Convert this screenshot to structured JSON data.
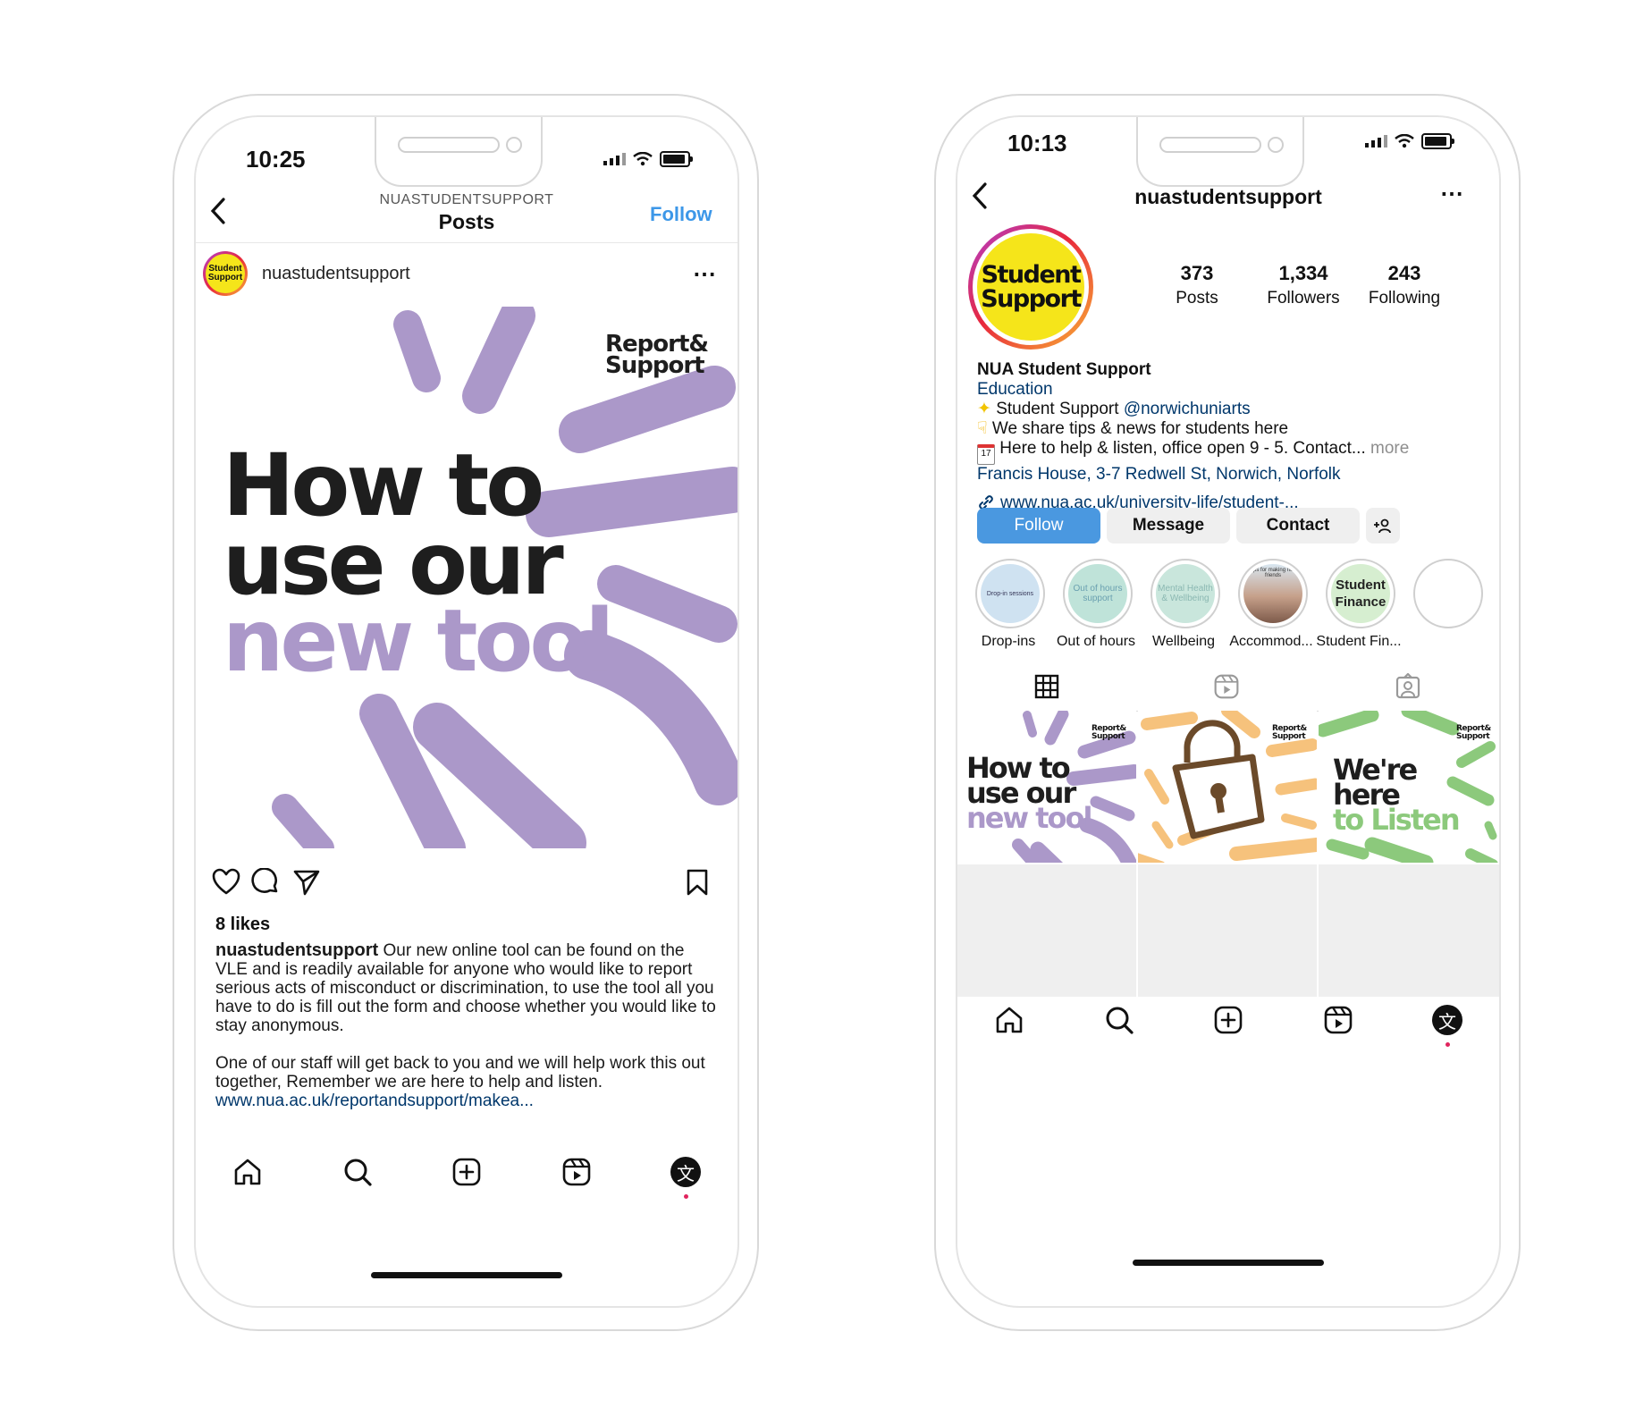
{
  "left_phone": {
    "status": {
      "time": "10:25"
    },
    "header": {
      "account_upper": "NUASTUDENTSUPPORT",
      "title": "Posts",
      "follow": "Follow"
    },
    "post_author": {
      "avatar_text": "Student Support",
      "username": "nuastudentsupport"
    },
    "post_image": {
      "brand": "Report& Support",
      "line1": "How to",
      "line2": "use our",
      "line3": "new tool",
      "colors": {
        "accent": "#ab98c9",
        "dark": "#1e1e1e"
      }
    },
    "likes": "8 likes",
    "caption": {
      "username": "nuastudentsupport",
      "text1": "Our new online tool can be found on the VLE and is readily available for anyone who would like to report serious acts of misconduct or discrimination, to use the tool all you have to do is fill out the form and choose whether you would like to stay anonymous.",
      "text2": "One of our staff will get back to you and we will help work this out together, Remember we are here to help and listen.",
      "link": "www.nua.ac.uk/reportandsupport/makea..."
    },
    "nav": [
      "home-icon",
      "search-icon",
      "add-icon",
      "reels-icon",
      "profile-icon"
    ]
  },
  "right_phone": {
    "status": {
      "time": "10:13"
    },
    "header": {
      "username": "nuastudentsupport"
    },
    "profile": {
      "avatar_line1": "Student",
      "avatar_line2": "Support",
      "avatar_color": "#f5e51a",
      "stats": [
        {
          "value": "373",
          "label": "Posts"
        },
        {
          "value": "1,334",
          "label": "Followers"
        },
        {
          "value": "243",
          "label": "Following"
        }
      ],
      "name": "NUA Student Support",
      "category": "Education",
      "bio_line1_prefix": "Student Support",
      "bio_line1_mention": "@norwichuniarts",
      "bio_line2": "We share tips & news for students here",
      "bio_line3": "Here to help & listen, office open 9 - 5. Contact...",
      "bio_more": "more",
      "address": "Francis House, 3-7 Redwell St, Norwich, Norfolk",
      "website": "www.nua.ac.uk/university-life/student-..."
    },
    "buttons": {
      "follow": "Follow",
      "message": "Message",
      "contact": "Contact"
    },
    "highlights": [
      {
        "label": "Drop-ins",
        "inner": "Drop-in sessions"
      },
      {
        "label": "Out of hours",
        "inner": "Out of hours support"
      },
      {
        "label": "Wellbeing",
        "inner": "Mental Health & Wellbeing"
      },
      {
        "label": "Accommod...",
        "inner": "Tips for making new friends"
      },
      {
        "label": "Student Fin...",
        "inner": "Student Finance"
      }
    ],
    "grid": [
      {
        "brand": "Report& Support",
        "l1": "How to",
        "l2": "use our",
        "l3": "new tool",
        "accent": "#ab98c9"
      },
      {
        "brand": "Report& Support",
        "accent": "#f6c27c"
      },
      {
        "brand": "Report& Support",
        "l1": "We're",
        "l2": "here",
        "l3": "to Listen",
        "accent": "#8cc97c"
      }
    ]
  }
}
